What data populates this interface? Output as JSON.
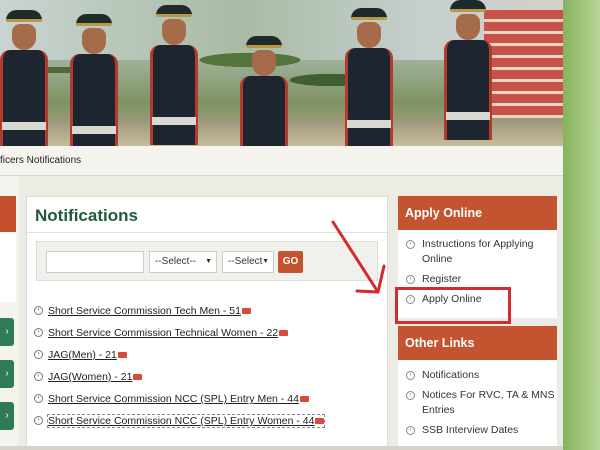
{
  "breadcrumb": "ficers Notifications",
  "notifications": {
    "title": "Notifications",
    "search_placeholder": "",
    "select1": "--Select--",
    "select2": "--Select",
    "go_label": "GO",
    "items": [
      {
        "label": "Short Service Commission Tech Men - 51"
      },
      {
        "label": "Short Service Commission Technical Women - 22"
      },
      {
        "label": "JAG(Men) - 21"
      },
      {
        "label": "JAG(Women) - 21"
      },
      {
        "label": "Short Service Commission NCC (SPL) Entry Men - 44"
      },
      {
        "label": "Short Service Commission NCC (SPL) Entry Women - 44"
      }
    ]
  },
  "apply_online": {
    "title": "Apply Online",
    "items": [
      {
        "label": "Instructions for Applying Online"
      },
      {
        "label": "Register"
      },
      {
        "label": "Apply Online"
      }
    ]
  },
  "other_links": {
    "title": "Other Links",
    "items": [
      {
        "label": "Notifications"
      },
      {
        "label": "Notices For RVC, TA & MNS Entries"
      },
      {
        "label": "SSB Interview Dates"
      }
    ]
  },
  "colors": {
    "accent": "#c4542f",
    "heading_green": "#1f5a3b",
    "annotation_red": "#d22c2c"
  },
  "icons": {
    "list_bullet": "circle-arrow-icon",
    "new_badge": "new-badge-icon"
  }
}
